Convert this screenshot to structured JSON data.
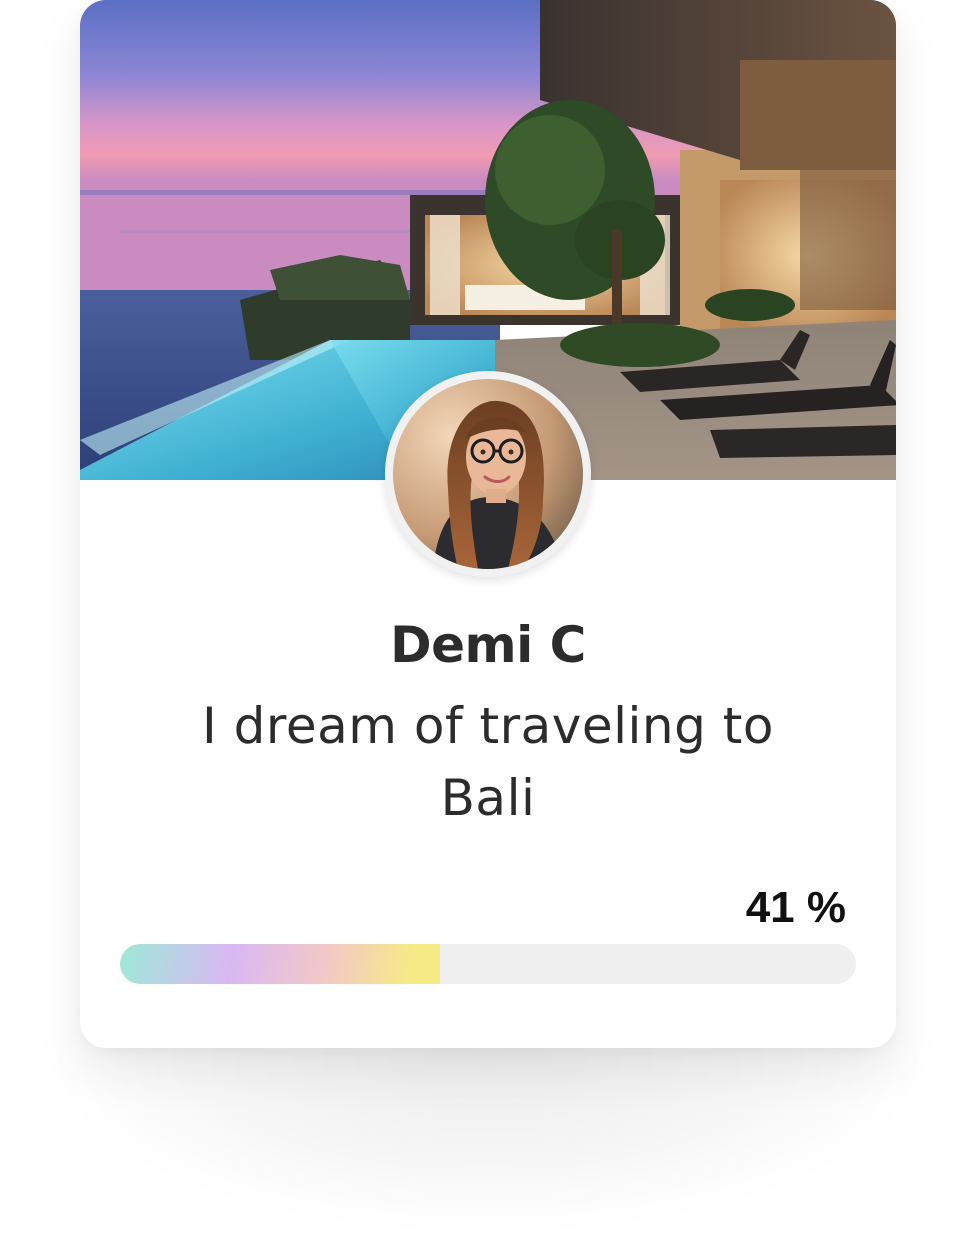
{
  "profile": {
    "name": "Demi C",
    "tagline": "I dream of traveling to Bali"
  },
  "goal": {
    "progress_label": "41 %",
    "progress_fraction": 0.435
  },
  "images": {
    "cover": "villa-infinity-pool-sunset-photo",
    "avatar": "woman-with-glasses-portrait-photo"
  },
  "colors": {
    "text_primary": "#2c2c2c",
    "track": "#f0f0f0",
    "gradient_start": "#9ee9d8",
    "gradient_mid": "#d9b8f2",
    "gradient_end": "#f6ea86"
  }
}
